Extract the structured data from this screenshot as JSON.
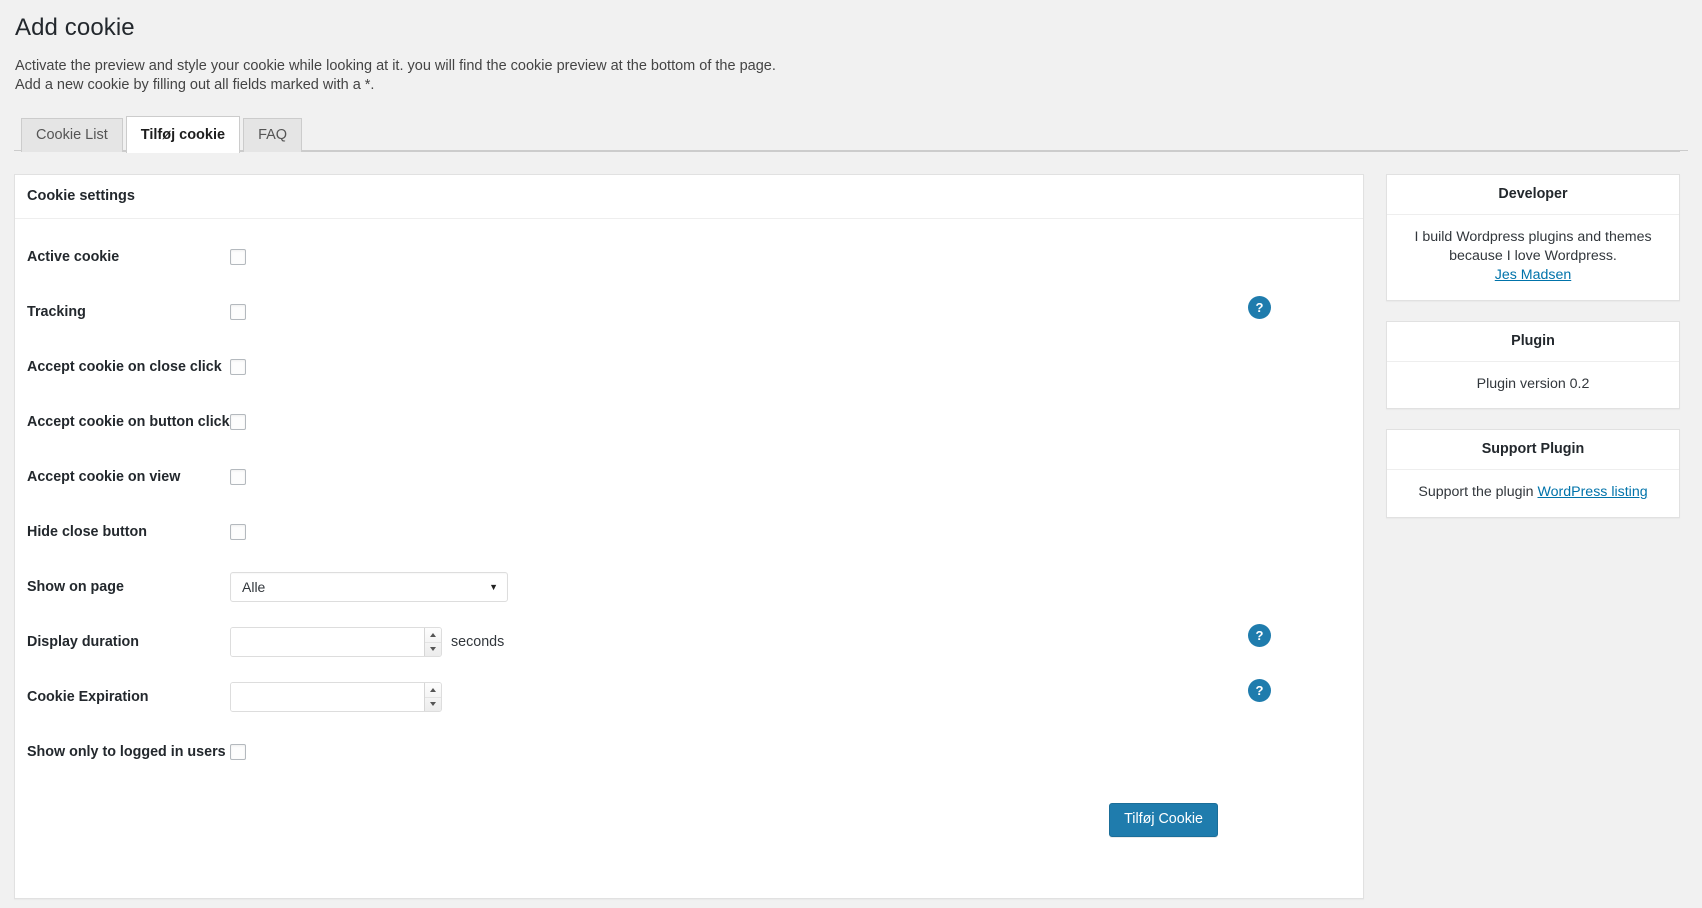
{
  "header": {
    "title": "Add cookie",
    "intro_line1": "Activate the preview and style your cookie while looking at it. you will find the cookie preview at the bottom of the page.",
    "intro_line2": "Add a new cookie by filling out all fields marked with a *."
  },
  "tabs": [
    {
      "label": "Cookie List",
      "active": false
    },
    {
      "label": "Tilføj cookie",
      "active": true
    },
    {
      "label": "FAQ",
      "active": false
    }
  ],
  "panel": {
    "heading": "Cookie settings",
    "rows": [
      {
        "label": "Active cookie",
        "type": "checkbox",
        "checked": false,
        "help": false
      },
      {
        "label": "Tracking",
        "type": "checkbox",
        "checked": false,
        "help": true
      },
      {
        "label": "Accept cookie on close click",
        "type": "checkbox",
        "checked": false,
        "help": false
      },
      {
        "label": "Accept cookie on button click",
        "type": "checkbox",
        "checked": false,
        "help": false
      },
      {
        "label": "Accept cookie on view",
        "type": "checkbox",
        "checked": false,
        "help": false
      },
      {
        "label": "Hide close button",
        "type": "checkbox",
        "checked": false,
        "help": false
      },
      {
        "label": "Show on page",
        "type": "select",
        "value": "Alle",
        "help": false
      },
      {
        "label": "Display duration",
        "type": "number",
        "value": "",
        "unit": "seconds",
        "help": true
      },
      {
        "label": "Cookie Expiration",
        "type": "number",
        "value": "",
        "unit": "",
        "help": true
      },
      {
        "label": "Show only to logged in users",
        "type": "checkbox",
        "checked": false,
        "help": false
      }
    ],
    "submit_label": "Tilføj Cookie",
    "help_glyph": "?"
  },
  "sidebar": {
    "cards": [
      {
        "title": "Developer",
        "text": "I build Wordpress plugins and themes because I love Wordpress.",
        "link": "Jes Madsen",
        "link_before": ""
      },
      {
        "title": "Plugin",
        "text": "Plugin version 0.2",
        "link": "",
        "link_before": ""
      },
      {
        "title": "Support Plugin",
        "text": "",
        "link": "WordPress listing",
        "link_before": "Support the plugin "
      }
    ]
  },
  "colors": {
    "accent": "#1f7cad",
    "link": "#0073aa",
    "page_bg": "#f1f1f1",
    "panel_bg": "#ffffff"
  }
}
